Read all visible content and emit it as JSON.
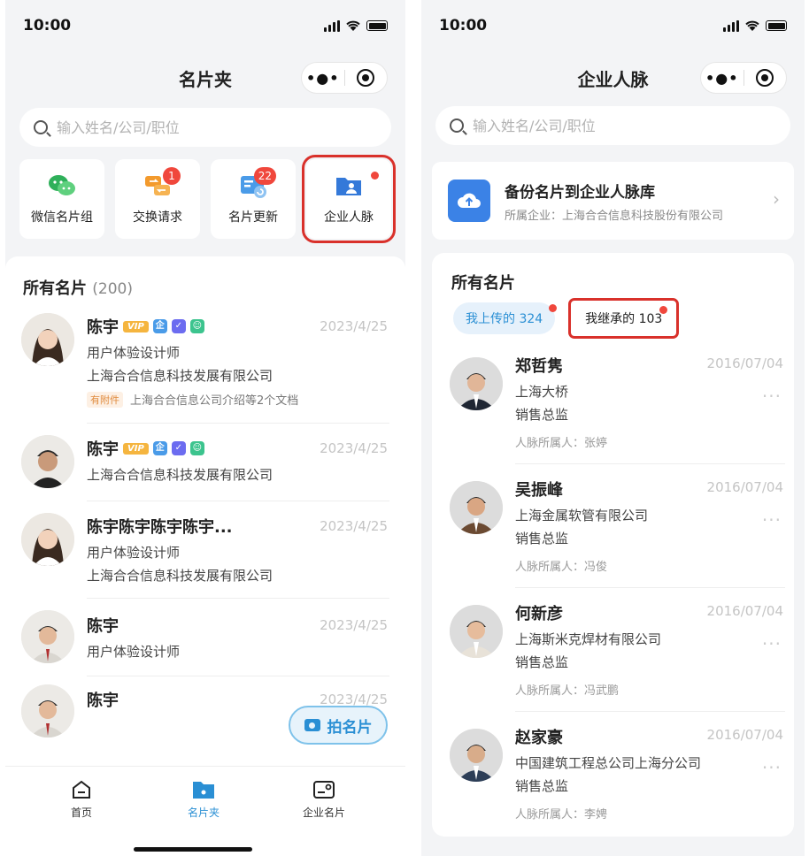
{
  "left": {
    "status": {
      "time": "10:00"
    },
    "nav": {
      "title": "名片夹"
    },
    "search": {
      "placeholder": "输入姓名/公司/职位"
    },
    "quick": [
      {
        "label": "微信名片组",
        "icon": "wechat-group-icon"
      },
      {
        "label": "交换请求",
        "icon": "exchange-icon",
        "badge": "1"
      },
      {
        "label": "名片更新",
        "icon": "card-update-icon",
        "badge": "22"
      },
      {
        "label": "企业人脉",
        "icon": "enterprise-contacts-icon"
      }
    ],
    "section": {
      "title": "所有名片",
      "count": "(200)"
    },
    "cards": [
      {
        "name": "陈宇",
        "date": "2023/4/25",
        "title": "用户体验设计师",
        "company": "上海合合信息科技发展有限公司",
        "attach_tag": "有附件",
        "attach_text": "上海合合信息公司介绍等2个文档"
      },
      {
        "name": "陈宇",
        "date": "2023/4/25",
        "company": "上海合合信息科技发展有限公司"
      },
      {
        "name": "陈宇陈宇陈宇陈宇...",
        "date": "2023/4/25",
        "title": "用户体验设计师",
        "company": "上海合合信息科技发展有限公司"
      },
      {
        "name": "陈宇",
        "date": "2023/4/25",
        "title": "用户体验设计师"
      },
      {
        "name": "陈宇",
        "date": "2023/4/25"
      }
    ],
    "vip_label": "VIP",
    "fab": {
      "label": "拍名片"
    },
    "tabs": [
      {
        "label": "首页"
      },
      {
        "label": "名片夹"
      },
      {
        "label": "企业名片"
      }
    ]
  },
  "right": {
    "status": {
      "time": "10:00"
    },
    "nav": {
      "title": "企业人脉"
    },
    "search": {
      "placeholder": "输入姓名/公司/职位"
    },
    "backup": {
      "title": "备份名片到企业人脉库",
      "sub": "所属企业：上海合合信息科技股份有限公司"
    },
    "section": {
      "title": "所有名片"
    },
    "subtabs": [
      {
        "label": "我上传的 324"
      },
      {
        "label": "我继承的 103"
      }
    ],
    "contacts": [
      {
        "name": "郑哲隽",
        "date": "2016/07/04",
        "company": "上海大桥",
        "title": "销售总监",
        "owner": "人脉所属人：张婷"
      },
      {
        "name": "吴振峰",
        "date": "2016/07/04",
        "company": "上海金属软管有限公司",
        "title": "销售总监",
        "owner": "人脉所属人：冯俊"
      },
      {
        "name": "何新彦",
        "date": "2016/07/04",
        "company": "上海斯米克焊材有限公司",
        "title": "销售总监",
        "owner": "人脉所属人：冯武鹏"
      },
      {
        "name": "赵家豪",
        "date": "2016/07/04",
        "company": "中国建筑工程总公司上海分公司",
        "title": "销售总监",
        "owner": "人脉所属人：李娉"
      }
    ]
  }
}
